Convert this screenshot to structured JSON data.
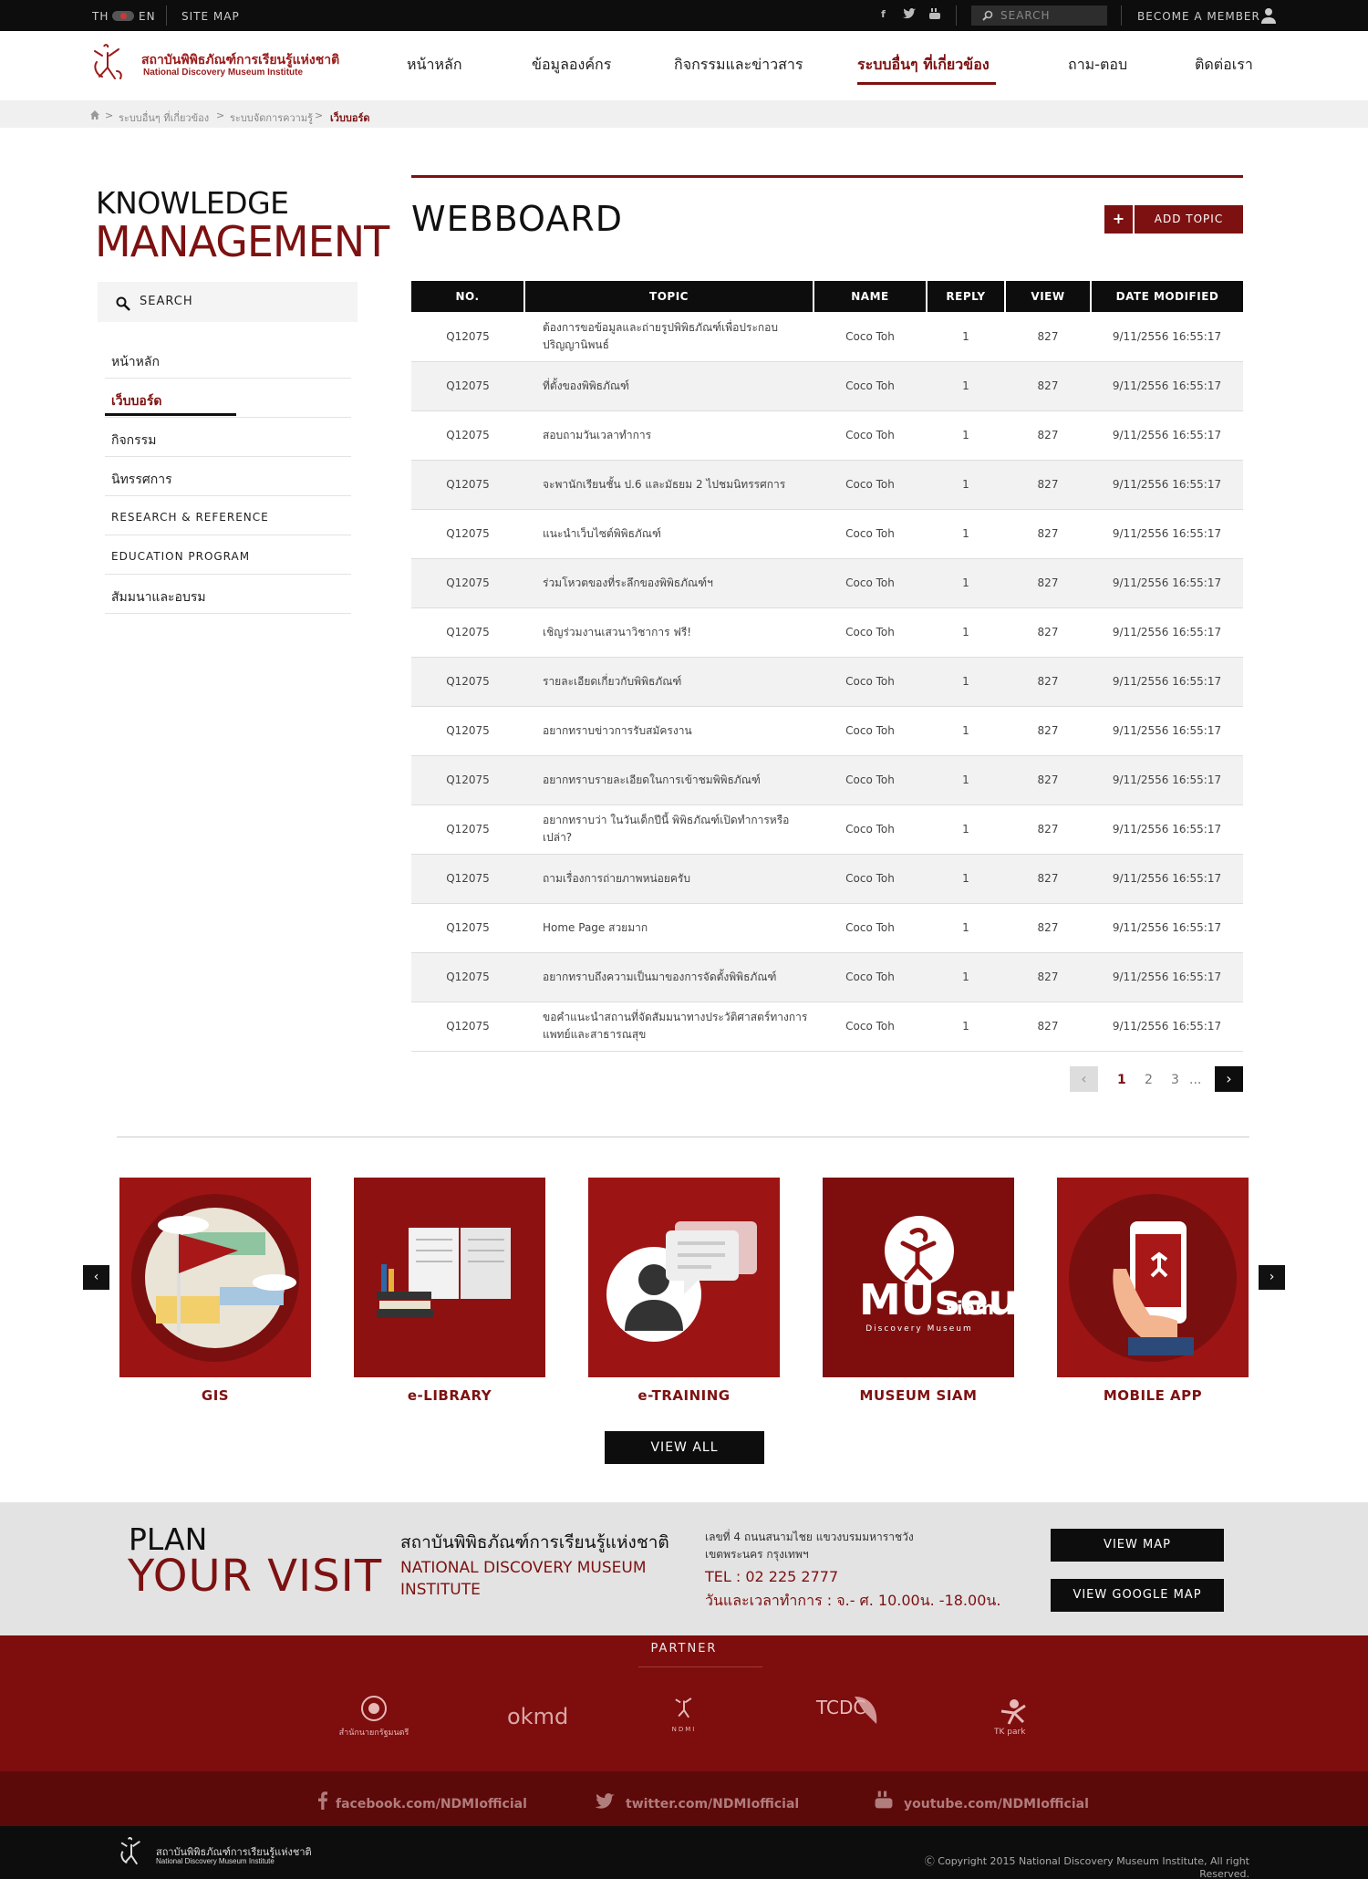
{
  "topbar": {
    "lang_th": "TH",
    "lang_en": "EN",
    "sitemap": "SITE MAP",
    "search_placeholder": "SEARCH",
    "member": "BECOME A MEMBER",
    "social_icons": [
      "facebook-icon",
      "twitter-icon",
      "youtube-icon"
    ]
  },
  "header": {
    "logo_th": "สถาบันพิพิธภัณฑ์การเรียนรู้แห่งชาติ",
    "logo_en": "National Discovery Museum Institute",
    "nav": [
      "หน้าหลัก",
      "ข้อมูลองค์กร",
      "กิจกรรมและข่าวสาร",
      "ระบบอื่นๆ ที่เกี่ยวข้อง",
      "ถาม-ตอบ",
      "ติดต่อเรา"
    ],
    "nav_active_index": 3
  },
  "breadcrumb": [
    "ระบบอื่นๆ ที่เกี่ยวข้อง",
    "ระบบจัดการความรู้",
    "เว็บบอร์ด"
  ],
  "sidebar": {
    "title_line1": "KNOWLEDGE",
    "title_line2": "MANAGEMENT",
    "search_label": "SEARCH",
    "items": [
      "หน้าหลัก",
      "เว็บบอร์ด",
      "กิจกรรม",
      "นิทรรศการ",
      "RESEARCH & REFERENCE",
      "EDUCATION PROGRAM",
      "สัมมนาและอบรม"
    ],
    "active_index": 1
  },
  "webboard": {
    "title": "WEBBOARD",
    "add_plus": "+",
    "add_label": "ADD TOPIC",
    "columns": [
      "NO.",
      "TOPIC",
      "NAME",
      "REPLY",
      "VIEW",
      "DATE MODIFIED"
    ],
    "rows": [
      [
        "Q12075",
        "ต้องการขอข้อมูลและถ่ายรูปพิพิธภัณฑ์เพื่อประกอบปริญญานิพนธ์",
        "Coco Toh",
        "1",
        "827",
        "9/11/2556 16:55:17"
      ],
      [
        "Q12075",
        "ที่ตั้งของพิพิธภัณฑ์",
        "Coco Toh",
        "1",
        "827",
        "9/11/2556 16:55:17"
      ],
      [
        "Q12075",
        "สอบถามวันเวลาทำการ",
        "Coco Toh",
        "1",
        "827",
        "9/11/2556 16:55:17"
      ],
      [
        "Q12075",
        "จะพานักเรียนชั้น ป.6 และมัธยม 2 ไปชมนิทรรศการ",
        "Coco Toh",
        "1",
        "827",
        "9/11/2556 16:55:17"
      ],
      [
        "Q12075",
        "แนะนำเว็บไซต์พิพิธภัณฑ์",
        "Coco Toh",
        "1",
        "827",
        "9/11/2556 16:55:17"
      ],
      [
        "Q12075",
        "ร่วมโหวตของที่ระลึกของพิพิธภัณฑ์ฯ",
        "Coco Toh",
        "1",
        "827",
        "9/11/2556 16:55:17"
      ],
      [
        "Q12075",
        "เชิญร่วมงานเสวนาวิชาการ ฟรี!",
        "Coco Toh",
        "1",
        "827",
        "9/11/2556 16:55:17"
      ],
      [
        "Q12075",
        "รายละเอียดเกี่ยวกับพิพิธภัณฑ์",
        "Coco Toh",
        "1",
        "827",
        "9/11/2556 16:55:17"
      ],
      [
        "Q12075",
        "อยากทราบข่าวการรับสมัครงาน",
        "Coco Toh",
        "1",
        "827",
        "9/11/2556 16:55:17"
      ],
      [
        "Q12075",
        "อยากทราบรายละเอียดในการเข้าชมพิพิธภัณฑ์",
        "Coco Toh",
        "1",
        "827",
        "9/11/2556 16:55:17"
      ],
      [
        "Q12075",
        "อยากทราบว่า ในวันเด็กปีนี้ พิพิธภัณฑ์เปิดทำการหรือเปล่า?",
        "Coco Toh",
        "1",
        "827",
        "9/11/2556 16:55:17"
      ],
      [
        "Q12075",
        "ถามเรื่องการถ่ายภาพหน่อยครับ",
        "Coco Toh",
        "1",
        "827",
        "9/11/2556 16:55:17"
      ],
      [
        "Q12075",
        "Home Page สวยมาก",
        "Coco Toh",
        "1",
        "827",
        "9/11/2556 16:55:17"
      ],
      [
        "Q12075",
        "อยากทราบถึงความเป็นมาของการจัดตั้งพิพิธภัณฑ์",
        "Coco Toh",
        "1",
        "827",
        "9/11/2556 16:55:17"
      ],
      [
        "Q12075",
        "ขอคำแนะนำสถานที่จัดสัมมนาทางประวัติศาสตร์ทางการแพทย์และสาธารณสุข",
        "Coco Toh",
        "1",
        "827",
        "9/11/2556 16:55:17"
      ]
    ],
    "pagination": {
      "pages": [
        "1",
        "2",
        "3"
      ],
      "ellipsis": "...",
      "current": "1"
    }
  },
  "links": {
    "tiles": [
      "GIS",
      "e-LIBRARY",
      "e-TRAINING",
      "MUSEUM SIAM",
      "MOBILE APP"
    ],
    "museum_logo_line1": "MUseum",
    "museum_logo_line2": "siam",
    "museum_logo_sub": "Discovery Museum",
    "view_all": "VIEW ALL",
    "accent": "#9d1414"
  },
  "visit": {
    "plan": "PLAN",
    "your_visit": "YOUR VISIT",
    "inst_th": "สถาบันพิพิธภัณฑ์การเรียนรู้แห่งชาติ",
    "inst_en": "NATIONAL DISCOVERY MUSEUM INSTITUTE",
    "address": "เลขที่ 4 ถนนสนามไชย แขวงบรมมหาราชวัง เขตพระนคร กรุงเทพฯ",
    "tel": "TEL : 02 225 2777",
    "hours": "วันและเวลาทำการ : จ.- ศ. 10.00น. -18.00น.",
    "view_map": "VIEW MAP",
    "view_google_map": "VIEW GOOGLE MAP"
  },
  "partner": {
    "label": "PARTNER",
    "logos": [
      "สำนักนายกรัฐมนตรี",
      "okmd",
      "NDMI",
      "TCDC",
      "TK park"
    ]
  },
  "social": [
    "facebook.com/NDMIofficial",
    "twitter.com/NDMIofficial",
    "youtube.com/NDMIofficial"
  ],
  "footer": {
    "logo_th": "สถาบันพิพิธภัณฑ์การเรียนรู้แห่งชาติ",
    "logo_en": "National Discovery Museum Institute",
    "copyright": "Copyright 2015 National Discovery Museum Institute, All right Reserved."
  },
  "colors": {
    "brand": "#7d1111",
    "dark": "#0d0d0d",
    "partner_bg": "#7e0d0d"
  }
}
